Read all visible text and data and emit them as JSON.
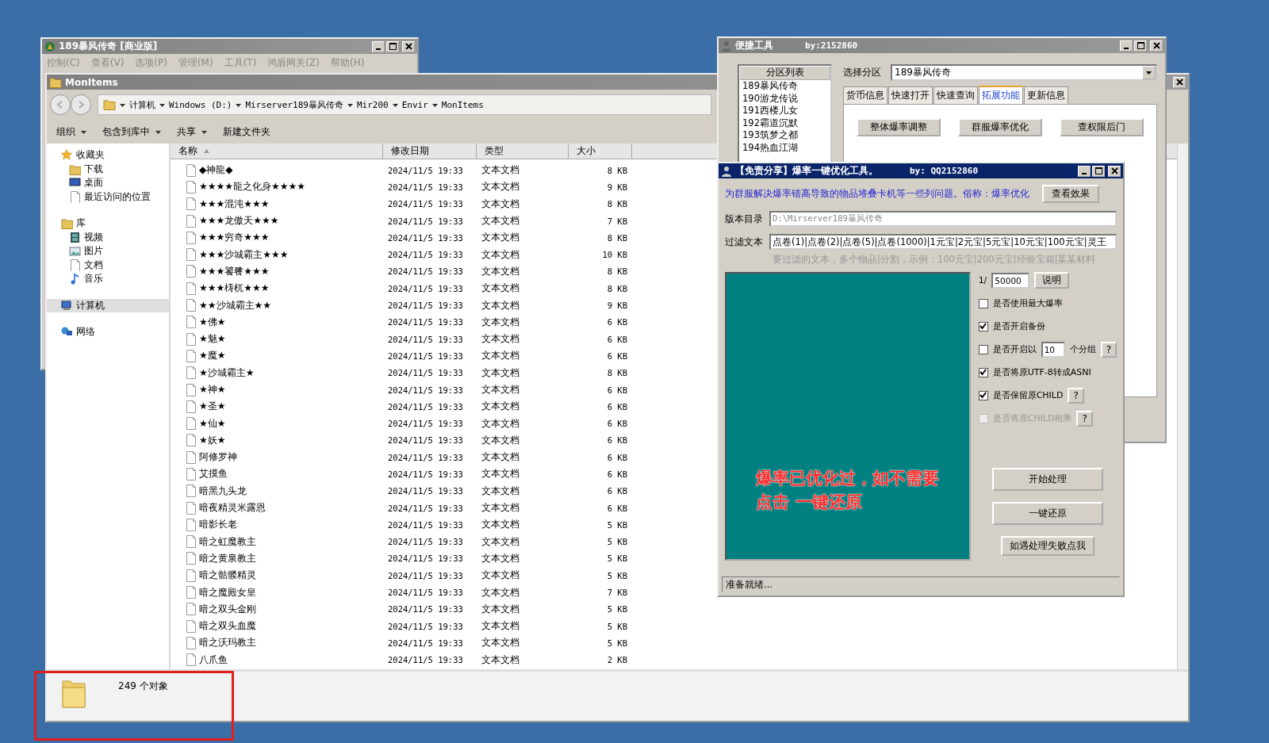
{
  "server_window": {
    "title": "189暴风传奇 [商业版]",
    "menu": [
      "控制(C)",
      "查看(V)",
      "选项(P)",
      "管理(M)",
      "工具(T)",
      "鸿盾网关(Z)",
      "帮助(H)"
    ]
  },
  "explorer": {
    "title": "MonItems",
    "breadcrumb": [
      "计算机",
      "Windows (D:)",
      "Mirserver189暴风传奇",
      "Mir200",
      "Envir",
      "MonItems"
    ],
    "toolbar": [
      {
        "label": "组织",
        "dropdown": true
      },
      {
        "label": "包含到库中",
        "dropdown": true
      },
      {
        "label": "共享",
        "dropdown": true
      },
      {
        "label": "新建文件夹",
        "dropdown": false
      }
    ],
    "sidebar": [
      {
        "label": "收藏夹",
        "selected": false,
        "children": [
          {
            "label": "下载",
            "selected": false
          },
          {
            "label": "桌面",
            "selected": false
          },
          {
            "label": "最近访问的位置",
            "selected": false
          }
        ]
      },
      {
        "label": "库",
        "selected": false,
        "children": [
          {
            "label": "视频",
            "selected": false
          },
          {
            "label": "图片",
            "selected": false
          },
          {
            "label": "文档",
            "selected": false
          },
          {
            "label": "音乐",
            "selected": false
          }
        ]
      },
      {
        "label": "计算机",
        "selected": true
      },
      {
        "label": "网络",
        "selected": false
      }
    ],
    "columns": [
      "名称",
      "修改日期",
      "类型",
      "大小"
    ],
    "rows": [
      {
        "name": "◆神龍◆",
        "modified": "2024/11/5 19:33",
        "type": "文本文档",
        "size": "8 KB"
      },
      {
        "name": "★★★★龍之化身★★★★",
        "modified": "2024/11/5 19:33",
        "type": "文本文档",
        "size": "9 KB"
      },
      {
        "name": "★★★混沌★★★",
        "modified": "2024/11/5 19:33",
        "type": "文本文档",
        "size": "8 KB"
      },
      {
        "name": "★★★龙傲天★★★",
        "modified": "2024/11/5 19:33",
        "type": "文本文档",
        "size": "7 KB"
      },
      {
        "name": "★★★穷奇★★★",
        "modified": "2024/11/5 19:33",
        "type": "文本文档",
        "size": "8 KB"
      },
      {
        "name": "★★★沙城霸主★★★",
        "modified": "2024/11/5 19:33",
        "type": "文本文档",
        "size": "10 KB"
      },
      {
        "name": "★★★饕餮★★★",
        "modified": "2024/11/5 19:33",
        "type": "文本文档",
        "size": "8 KB"
      },
      {
        "name": "★★★梼杌★★★",
        "modified": "2024/11/5 19:33",
        "type": "文本文档",
        "size": "8 KB"
      },
      {
        "name": "★★沙城霸主★★",
        "modified": "2024/11/5 19:33",
        "type": "文本文档",
        "size": "9 KB"
      },
      {
        "name": "★佛★",
        "modified": "2024/11/5 19:33",
        "type": "文本文档",
        "size": "6 KB"
      },
      {
        "name": "★魅★",
        "modified": "2024/11/5 19:33",
        "type": "文本文档",
        "size": "6 KB"
      },
      {
        "name": "★魔★",
        "modified": "2024/11/5 19:33",
        "type": "文本文档",
        "size": "6 KB"
      },
      {
        "name": "★沙城霸主★",
        "modified": "2024/11/5 19:33",
        "type": "文本文档",
        "size": "8 KB"
      },
      {
        "name": "★神★",
        "modified": "2024/11/5 19:33",
        "type": "文本文档",
        "size": "6 KB"
      },
      {
        "name": "★圣★",
        "modified": "2024/11/5 19:33",
        "type": "文本文档",
        "size": "6 KB"
      },
      {
        "name": "★仙★",
        "modified": "2024/11/5 19:33",
        "type": "文本文档",
        "size": "6 KB"
      },
      {
        "name": "★妖★",
        "modified": "2024/11/5 19:33",
        "type": "文本文档",
        "size": "6 KB"
      },
      {
        "name": "阿修罗神",
        "modified": "2024/11/5 19:33",
        "type": "文本文档",
        "size": "6 KB"
      },
      {
        "name": "艾摸鱼",
        "modified": "2024/11/5 19:33",
        "type": "文本文档",
        "size": "6 KB"
      },
      {
        "name": "暗黑九头龙",
        "modified": "2024/11/5 19:33",
        "type": "文本文档",
        "size": "6 KB"
      },
      {
        "name": "暗夜精灵米露恩",
        "modified": "2024/11/5 19:33",
        "type": "文本文档",
        "size": "6 KB"
      },
      {
        "name": "暗影长老",
        "modified": "2024/11/5 19:33",
        "type": "文本文档",
        "size": "5 KB"
      },
      {
        "name": "暗之虹魔教主",
        "modified": "2024/11/5 19:33",
        "type": "文本文档",
        "size": "5 KB"
      },
      {
        "name": "暗之黄泉教主",
        "modified": "2024/11/5 19:33",
        "type": "文本文档",
        "size": "5 KB"
      },
      {
        "name": "暗之骷髅精灵",
        "modified": "2024/11/5 19:33",
        "type": "文本文档",
        "size": "5 KB"
      },
      {
        "name": "暗之魔殿女皇",
        "modified": "2024/11/5 19:33",
        "type": "文本文档",
        "size": "7 KB"
      },
      {
        "name": "暗之双头金刚",
        "modified": "2024/11/5 19:33",
        "type": "文本文档",
        "size": "5 KB"
      },
      {
        "name": "暗之双头血魔",
        "modified": "2024/11/5 19:33",
        "type": "文本文档",
        "size": "5 KB"
      },
      {
        "name": "暗之沃玛教主",
        "modified": "2024/11/5 19:33",
        "type": "文本文档",
        "size": "5 KB"
      },
      {
        "name": "八爪鱼",
        "modified": "2024/11/5 19:33",
        "type": "文本文档",
        "size": "2 KB"
      }
    ],
    "status": "249 个对象"
  },
  "quick_tool": {
    "title": "便捷工具",
    "author": "by:2152860",
    "list_header": "分区列表",
    "partitions": [
      "189暴风传奇",
      "190游龙传说",
      "191西楼儿女",
      "192霸道沉默",
      "193筑梦之都",
      "194热血江湖"
    ],
    "select_label": "选择分区",
    "select_value": "189暴风传奇",
    "tabs": [
      {
        "label": "货币信息",
        "selected": false
      },
      {
        "label": "快速打开",
        "selected": false
      },
      {
        "label": "快速查询",
        "selected": false
      },
      {
        "label": "拓展功能",
        "selected": true
      },
      {
        "label": "更新信息",
        "selected": false
      }
    ],
    "buttons": [
      "整体爆率调整",
      "群服爆率优化",
      "查权限后门"
    ]
  },
  "optimizer": {
    "title": "【免责分享】爆率一键优化工具。",
    "author": "by: QQ2152860",
    "description": "为群服解决爆率错高导致的物品堆叠卡机等一些列问题。俗称：爆率优化",
    "view_button": "查看效果",
    "dir_label": "版本目录",
    "dir_value": "D:\\Mirserver189暴风传奇",
    "filter_label": "过滤文本",
    "filter_value": "点卷(1)|点卷(2)|点卷(5)|点卷(1000)|1元宝|2元宝|5元宝|10元宝|100元宝|灵王",
    "filter_hint": "要过滤的文本，多个物品|分割，示例：100元宝|200元宝|经验宝箱|某某材料",
    "notice": [
      "爆率已优化过，如不需要",
      "点击 一键还原"
    ],
    "ratio_label": "1/",
    "ratio_value": "50000",
    "ratio_button": "说明",
    "options": [
      {
        "kind": "check",
        "label": "是否使用最大爆率",
        "checked": false,
        "disabled": false
      },
      {
        "kind": "check",
        "label": "是否开启备份",
        "checked": true,
        "disabled": false
      },
      {
        "kind": "count",
        "label": "是否开启以",
        "value": "10",
        "suffix": "个分组",
        "help": "?",
        "checked": false,
        "disabled": false
      },
      {
        "kind": "check",
        "label": "是否将原UTF-8转成ASNI",
        "checked": true,
        "disabled": false
      },
      {
        "kind": "check",
        "label": "是否保留原CHILD",
        "help": "?",
        "checked": true,
        "disabled": false
      },
      {
        "kind": "check",
        "label": "是否将原CHILD相乘",
        "help": "?",
        "checked": false,
        "disabled": true
      }
    ],
    "actions": [
      "开始处理",
      "一键还原",
      "如遇处理失败点我"
    ],
    "status": "准备就绪..."
  }
}
